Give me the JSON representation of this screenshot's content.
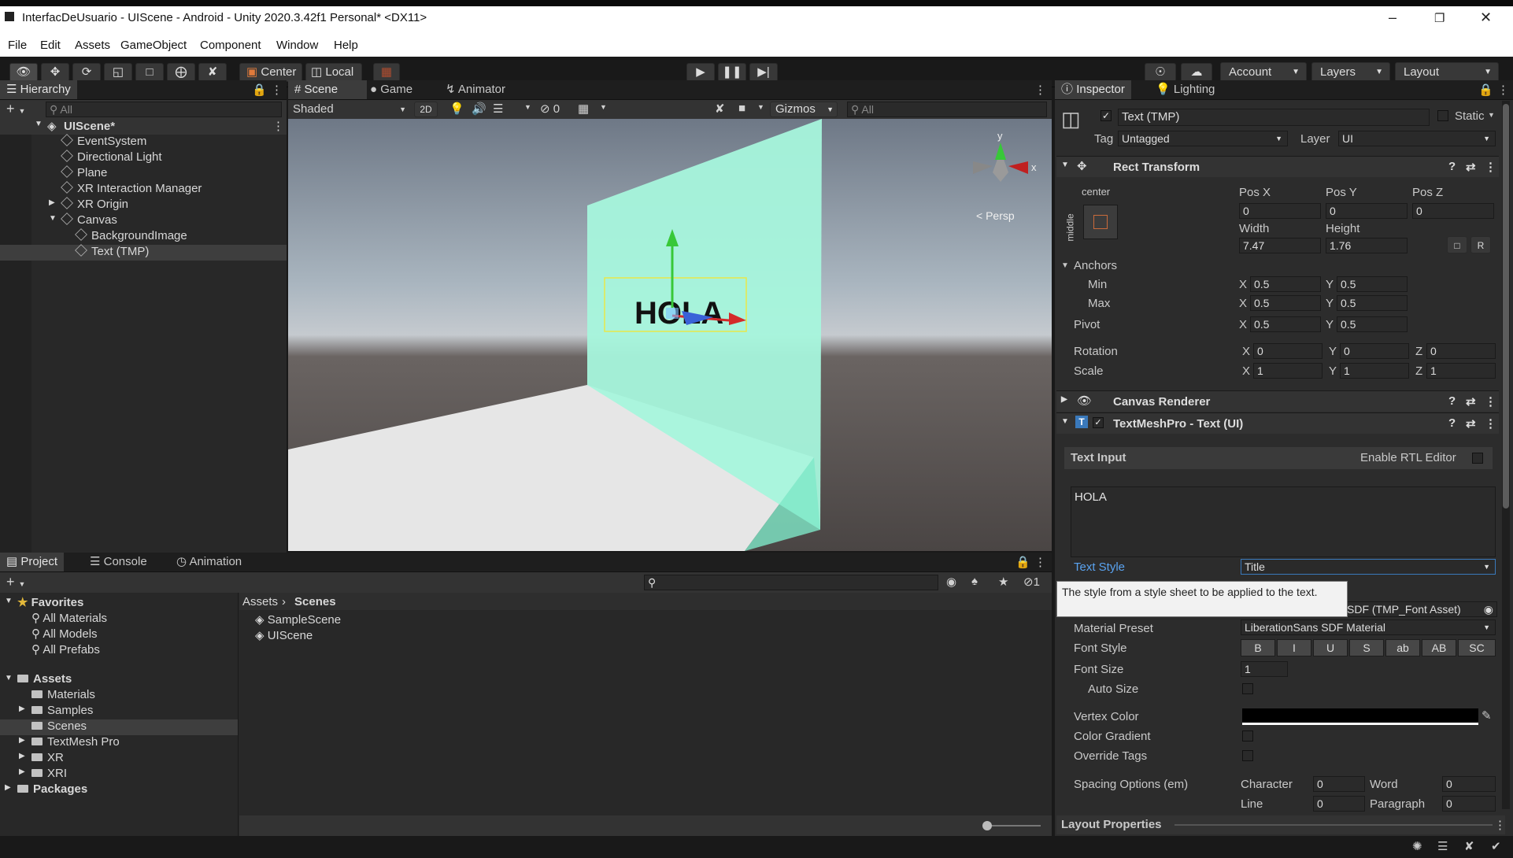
{
  "window": {
    "title": "InterfacDeUsuario - UIScene - Android - Unity 2020.3.42f1 Personal* <DX11>"
  },
  "menu": [
    "File",
    "Edit",
    "Assets",
    "GameObject",
    "Component",
    "Window",
    "Help"
  ],
  "toolbar": {
    "pivot": "Center",
    "space": "Local",
    "account": "Account",
    "layers": "Layers",
    "layout": "Layout"
  },
  "hierarchy": {
    "tab": "Hierarchy",
    "search_placeholder": "All",
    "scene": "UIScene*",
    "items": [
      "EventSystem",
      "Directional Light",
      "Plane",
      "XR Interaction Manager",
      "XR Origin",
      "Canvas",
      "BackgroundImage",
      "Text (TMP)"
    ]
  },
  "scene_view": {
    "tabs": [
      "Scene",
      "Game",
      "Animator"
    ],
    "shading": "Shaded",
    "mode_2d": "2D",
    "hidden_count": "0",
    "gizmos": "Gizmos",
    "search_placeholder": "All",
    "persp": "< Persp",
    "axis_x": "x",
    "axis_y": "y",
    "canvas_text": "HOLA"
  },
  "project": {
    "tabs": [
      "Project",
      "Console",
      "Animation"
    ],
    "hidden_count": "1",
    "favorites": "Favorites",
    "favorite_items": [
      "All Materials",
      "All Models",
      "All Prefabs"
    ],
    "assets": "Assets",
    "asset_folders": [
      "Materials",
      "Samples",
      "Scenes",
      "TextMesh Pro",
      "XR",
      "XRI"
    ],
    "packages": "Packages",
    "breadcrumb": [
      "Assets",
      "Scenes"
    ],
    "files": [
      "SampleScene",
      "UIScene"
    ]
  },
  "inspector": {
    "tabs": [
      "Inspector",
      "Lighting"
    ],
    "object_name": "Text (TMP)",
    "static": "Static",
    "tag_label": "Tag",
    "tag_value": "Untagged",
    "layer_label": "Layer",
    "layer_value": "UI",
    "rect_transform": {
      "title": "Rect Transform",
      "anchor_h": "center",
      "anchor_v": "middle",
      "pos_labels": [
        "Pos X",
        "Pos Y",
        "Pos Z"
      ],
      "pos_values": [
        "0",
        "0",
        "0"
      ],
      "size_labels": [
        "Width",
        "Height"
      ],
      "size_values": [
        "7.47",
        "1.76"
      ],
      "anchors": "Anchors",
      "min": "Min",
      "max": "Max",
      "pivot": "Pivot",
      "rotation": "Rotation",
      "scale": "Scale",
      "x": "X",
      "y": "Y",
      "z": "Z",
      "min_values": [
        "0.5",
        "0.5"
      ],
      "max_values": [
        "0.5",
        "0.5"
      ],
      "pivot_values": [
        "0.5",
        "0.5"
      ],
      "rotation_values": [
        "0",
        "0",
        "0"
      ],
      "scale_values": [
        "1",
        "1",
        "1"
      ]
    },
    "canvas_renderer": "Canvas Renderer",
    "tmp": {
      "title": "TextMeshPro - Text (UI)",
      "text_input": "Text Input",
      "rtl": "Enable RTL Editor",
      "text": "HOLA",
      "text_style_label": "Text Style",
      "text_style_value": "Title",
      "tooltip": "The style from a style sheet to be applied to the text.",
      "font_asset_partial": "SDF (TMP_Font Asset)",
      "material_preset_label": "Material Preset",
      "material_preset_value": "LiberationSans SDF Material",
      "font_style_label": "Font Style",
      "font_style_buttons": [
        "B",
        "I",
        "U",
        "S",
        "ab",
        "AB",
        "SC"
      ],
      "font_size_label": "Font Size",
      "font_size_value": "1",
      "auto_size": "Auto Size",
      "vertex_color": "Vertex Color",
      "color_gradient": "Color Gradient",
      "override_tags": "Override Tags",
      "spacing": "Spacing Options (em)",
      "character": "Character",
      "character_value": "0",
      "word": "Word",
      "word_value": "0",
      "line": "Line",
      "line_value": "0",
      "paragraph": "Paragraph",
      "paragraph_value": "0",
      "layout_properties": "Layout Properties"
    }
  },
  "colors": {
    "accent": "#3a79bb",
    "canvas": "#a7f5dc",
    "x_axis": "#d42a2a",
    "y_axis": "#38c838",
    "selection": "#2c5d87"
  }
}
